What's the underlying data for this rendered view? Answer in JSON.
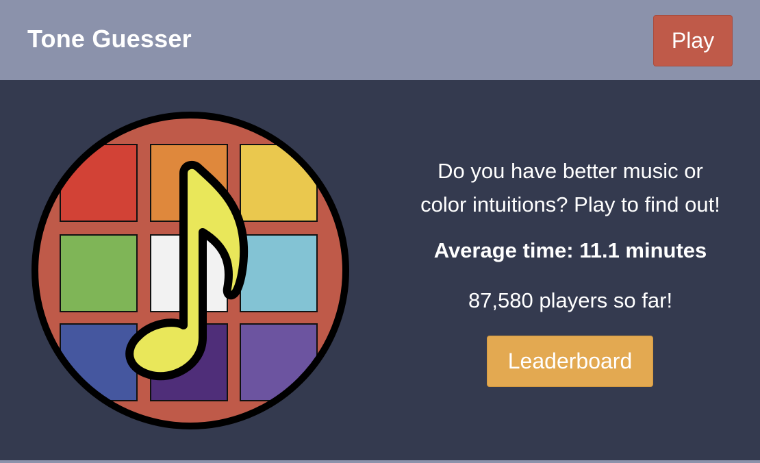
{
  "header": {
    "title": "Tone Guesser",
    "play_label": "Play"
  },
  "logo": {
    "icon": "music-note-icon",
    "tile_colors": [
      "#d24236",
      "#df883c",
      "#eac84e",
      "#7fb557",
      "#f2f2f2",
      "#83c3d4",
      "#45579f",
      "#4f2e79",
      "#6c54a0"
    ],
    "ring_color": "#bf5a49",
    "note_color": "#e9e75a"
  },
  "main": {
    "tagline_line1": "Do you have better music or",
    "tagline_line2": "color intuitions? Play to find out!",
    "average_time": "Average time: 11.1 minutes",
    "players": "87,580 players so far!",
    "leaderboard_label": "Leaderboard"
  },
  "colors": {
    "header_bg": "#8b92ab",
    "page_bg": "#343a4f",
    "play_button": "#bf5a49",
    "leaderboard_button": "#e3a951"
  }
}
